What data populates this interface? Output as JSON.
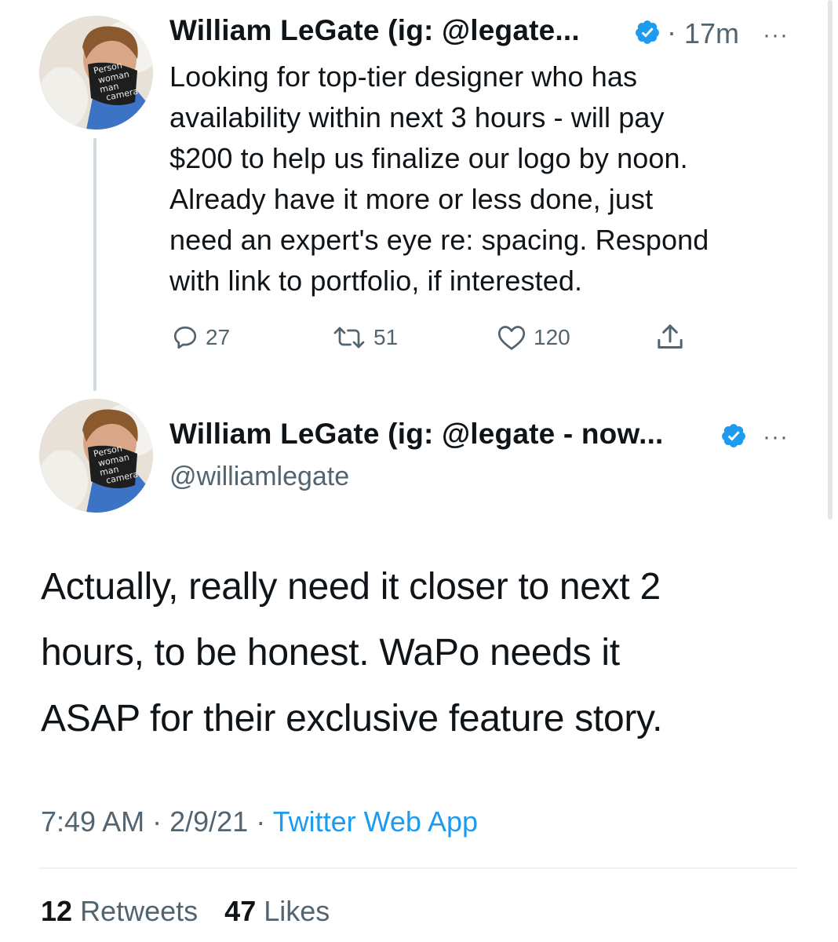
{
  "parent_tweet": {
    "display_name": "William LeGate (ig: @legate...",
    "time": "17m",
    "more": "···",
    "text": "Looking for top-tier designer who has\navailability within next 3 hours - will pay\n$200 to help us finalize our logo by noon.\nAlready have it more or less done, just\nneed an expert's eye re: spacing. Respond\nwith link to portfolio, if interested.",
    "actions": {
      "replies": "27",
      "retweets": "51",
      "likes": "120"
    },
    "icons": [
      "reply-icon",
      "retweet-icon",
      "like-icon",
      "share-icon",
      "verified-badge-icon"
    ]
  },
  "main_tweet": {
    "display_name": "William LeGate (ig: @legate - now...",
    "handle": "@williamlegate",
    "more": "···",
    "text": "Actually, really need it closer to next 2\nhours, to be honest. WaPo needs it\nASAP for their exclusive feature story.",
    "time": "7:49 AM",
    "date": "2/9/21",
    "source": "Twitter Web App",
    "retweet_count": "12",
    "retweet_label": "Retweets",
    "like_count": "47",
    "like_label": "Likes"
  },
  "mask_text": [
    "Person",
    "woman",
    "man",
    "camera"
  ],
  "colors": {
    "accent": "#1d9bf0",
    "text": "#0f1419",
    "muted": "#536471",
    "thread_line": "#cfd9de"
  }
}
